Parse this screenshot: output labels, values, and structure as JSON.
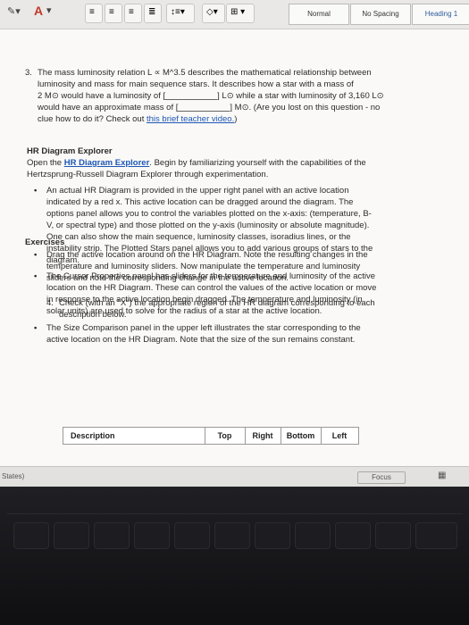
{
  "toolbar": {
    "font_color_label": "A",
    "style_normal": "Normal",
    "style_no_spacing": "No Spacing",
    "style_heading1": "Heading 1"
  },
  "q3": {
    "number": "3.",
    "line1": "The mass luminosity relation L ∝ M^3.5 describes the mathematical relationship between",
    "line2": "luminosity and mass for main sequence stars. It describes how a star with a mass of",
    "line3a": "2 M⊙ would have a luminosity of [",
    "line3b": "] L⊙ while a star with luminosity of 3,160 L⊙",
    "line4a": "would have an approximate mass of [",
    "line4b": "] M⊙. (Are you lost on this question - no",
    "line5a": "clue how to do it? Check out ",
    "line5_link": "this brief teacher video.",
    "line5b": ")"
  },
  "hr": {
    "title": "HR Diagram Explorer",
    "open_a": "Open the ",
    "open_link": "HR Diagram Explorer",
    "open_b": ". Begin by familiarizing yourself with the capabilities of the",
    "open_line2": "Hertzsprung-Russell Diagram Explorer through experimentation.",
    "b1": [
      "An actual HR Diagram is provided in the upper right panel with an active location",
      "indicated by a red x. This active location can be dragged around the diagram. The",
      "options panel allows you to control the variables plotted on the x-axis: (temperature, B-",
      "V, or spectral type) and those plotted on the y-axis (luminosity or absolute magnitude).",
      "One can also show the main sequence, luminosity classes, isoradius lines, or the",
      "instability strip. The Plotted Stars panel allows you to add various groups of stars to the",
      "diagram."
    ],
    "b2": [
      "The Cursor Properties panel has sliders for the temperature and luminosity of the active",
      "location on the HR Diagram. These can control the values of the active location or move",
      "in response to the active location begin dragged. The temperature and luminosity (in",
      "solar units) are used to solve for the radius of a star at the active location."
    ],
    "b3": [
      "The Size Comparison panel in the upper left illustrates the star corresponding to the",
      "active location on the HR Diagram. Note that the size of the sun remains constant."
    ]
  },
  "exercises": {
    "title": "Exercises",
    "b1": [
      "Drag the active location around on the HR Diagram. Note the resulting changes in the",
      "temperature and luminosity sliders. Now manipulate the temperature and luminosity",
      "sliders and note the corresponding change in the active location."
    ]
  },
  "q4": {
    "number": "4.",
    "line1": "Check (with an \"X\") the appropriate region of the HR diagram corresponding to each",
    "line2": "description below."
  },
  "table": {
    "headers": [
      "Description",
      "Top",
      "Right",
      "Bottom",
      "Left"
    ]
  },
  "status": {
    "language": "States)",
    "focus": "Focus"
  }
}
